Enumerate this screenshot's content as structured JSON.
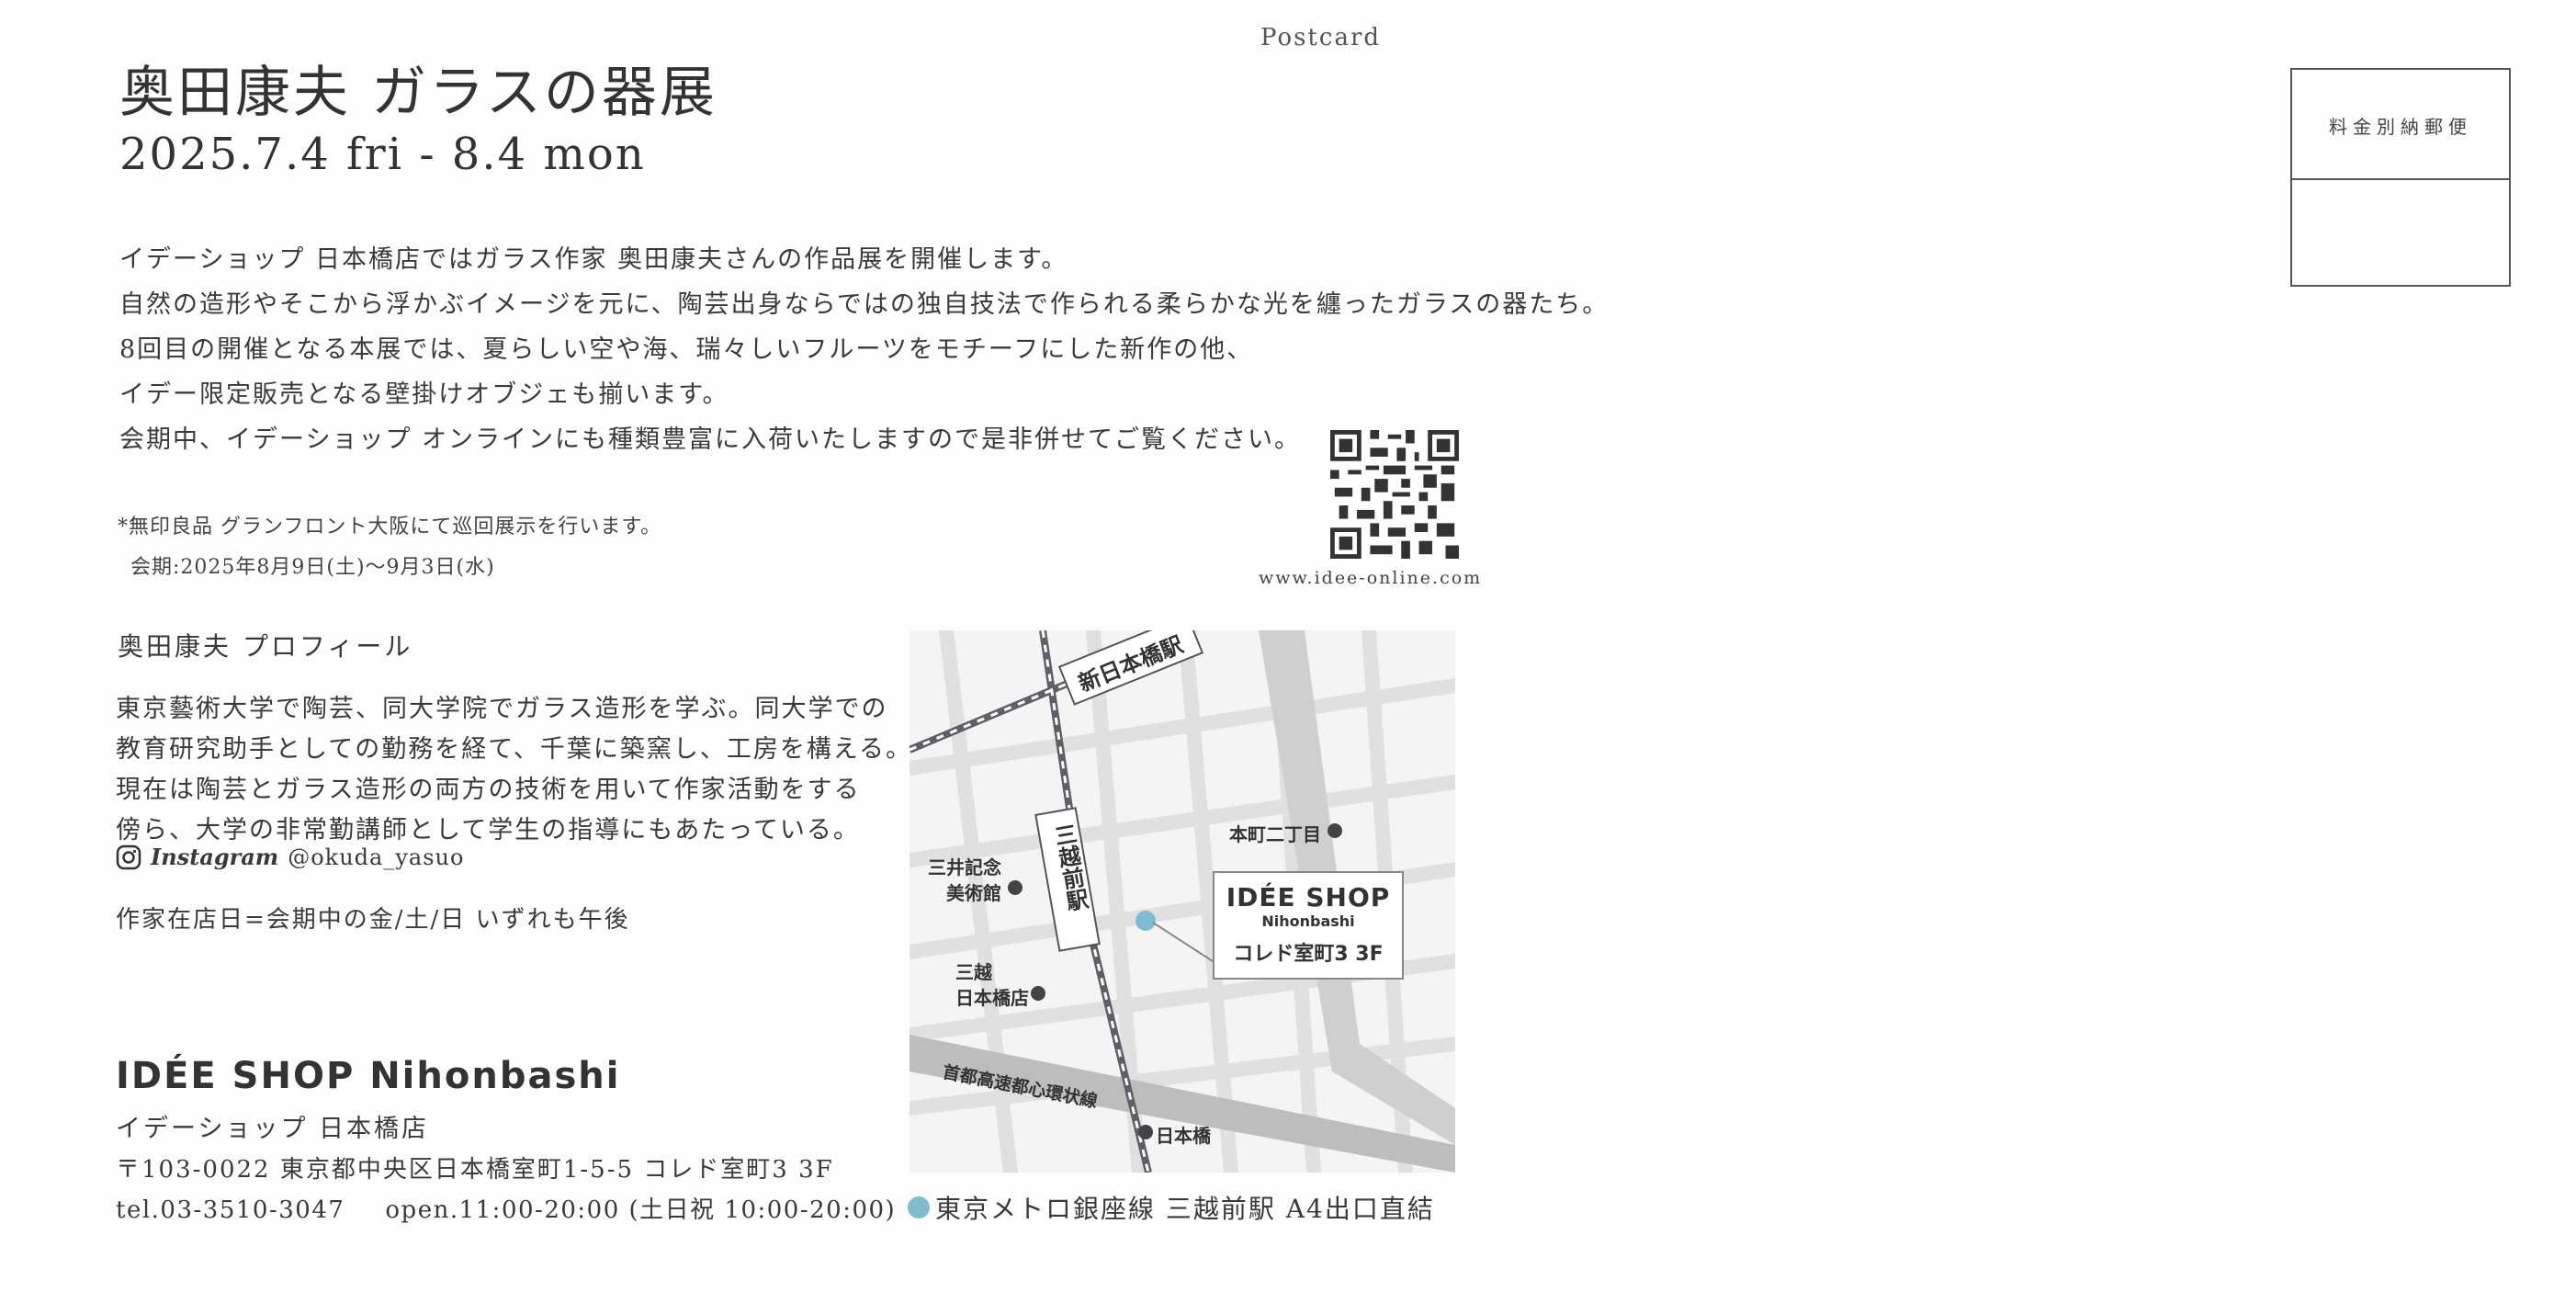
{
  "postcard_label": "Postcard",
  "title": "奥田康夫 ガラスの器展",
  "dates": "2025.7.4 fri - 8.4 mon",
  "intro": [
    "イデーショップ 日本橋店ではガラス作家 奥田康夫さんの作品展を開催します。",
    "自然の造形やそこから浮かぶイメージを元に、陶芸出身ならではの独自技法で作られる柔らかな光を纏ったガラスの器たち。",
    "8回目の開催となる本展では、夏らしい空や海、瑞々しいフルーツをモチーフにした新作の他、",
    "イデー限定販売となる壁掛けオブジェも揃います。",
    "会期中、イデーショップ オンラインにも種類豊富に入荷いたしますので是非併せてご覧ください。"
  ],
  "note": [
    "*無印良品 グランフロント大阪にて巡回展示を行います。",
    "会期:2025年8月9日(土)〜9月3日(水)"
  ],
  "qr_url": "www.idee-online.com",
  "stamp": "料金別納郵便",
  "profile": {
    "heading": "奥田康夫 プロフィール",
    "lines": [
      "東京藝術大学で陶芸、同大学院でガラス造形を学ぶ。同大学での",
      "教育研究助手としての勤務を経て、千葉に築窯し、工房を構える。",
      "現在は陶芸とガラス造形の両方の技術を用いて作家活動をする",
      "傍ら、大学の非常勤講師として学生の指導にもあたっている。"
    ],
    "instagram_label": "Instagram",
    "instagram_handle": "@okuda_yasuo",
    "presence": "作家在店日=会期中の金/土/日 いずれも午後"
  },
  "shop": {
    "name": "IDÉE SHOP Nihonbashi",
    "name_jp": "イデーショップ 日本橋店",
    "address": "〒103-0022 東京都中央区日本橋室町1-5-5 コレド室町3 3F",
    "tel": "tel.03-3510-3047",
    "hours": "open.11:00-20:00 (土日祝 10:00-20:00)"
  },
  "map": {
    "station_shin_nihonbashi": "新日本橋駅",
    "station_mitsukoshimae": "三越前駅",
    "mitsui_museum": [
      "三井記念",
      "美術館"
    ],
    "mitsukoshi": [
      "三越",
      "日本橋店"
    ],
    "honcho": "本町二丁目",
    "expressway": "首都高速都心環状線",
    "nihonbashi_bridge": "日本橋",
    "callout": {
      "line1": "IDÉE SHOP",
      "line2": "Nihonbashi",
      "line3": "コレド室町3 3F"
    }
  },
  "access": "東京メトロ銀座線 三越前駅 A4出口直結",
  "colors": {
    "accent_dot": "#7fbcd2",
    "map_road": "#e3e3e3",
    "map_rail": "#5d6066"
  }
}
